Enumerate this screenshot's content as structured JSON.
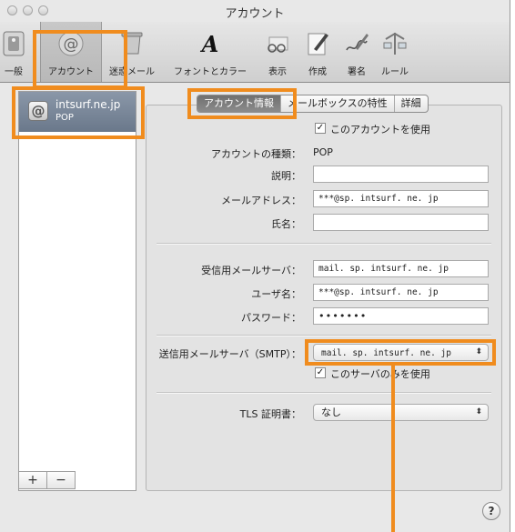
{
  "window": {
    "title": "アカウント"
  },
  "toolbar": {
    "items": [
      {
        "label": "一般",
        "icon": "switch-icon"
      },
      {
        "label": "アカウント",
        "icon": "at-sign-icon"
      },
      {
        "label": "迷惑メール",
        "icon": "junk-mail-icon"
      },
      {
        "label": "フォントとカラー",
        "icon": "font-icon"
      },
      {
        "label": "表示",
        "icon": "glasses-icon"
      },
      {
        "label": "作成",
        "icon": "compose-icon"
      },
      {
        "label": "署名",
        "icon": "signature-icon"
      },
      {
        "label": "ルール",
        "icon": "rules-icon"
      }
    ],
    "selected": "アカウント"
  },
  "sidebar": {
    "accounts": [
      {
        "name": "intsurf.ne.jp",
        "type": "POP",
        "icon": "at-sign-icon"
      }
    ],
    "add_label": "+",
    "remove_label": "−"
  },
  "tabs": [
    {
      "label": "アカウント情報",
      "active": true
    },
    {
      "label": "メールボックスの特性",
      "active": false
    },
    {
      "label": "詳細",
      "active": false
    }
  ],
  "form": {
    "enable_account": {
      "label": "このアカウントを使用",
      "checked": true
    },
    "account_type": {
      "label": "アカウントの種類：",
      "value": "POP"
    },
    "description": {
      "label": "説明：",
      "value": ""
    },
    "email": {
      "label": "メールアドレス：",
      "value": "***@sp. intsurf. ne. jp"
    },
    "full_name": {
      "label": "氏名：",
      "value": ""
    },
    "incoming_server": {
      "label": "受信用メールサーバ：",
      "value": "mail. sp. intsurf. ne. jp"
    },
    "username": {
      "label": "ユーザ名：",
      "value": "***@sp. intsurf. ne. jp"
    },
    "password": {
      "label": "パスワード：",
      "value": "•••••••"
    },
    "smtp": {
      "label": "送信用メールサーバ（SMTP）：",
      "value": "mail. sp. intsurf. ne. jp"
    },
    "only_this_server": {
      "label": "このサーバのみを使用",
      "checked": true
    },
    "tls": {
      "label": "TLS 証明書：",
      "value": "なし"
    }
  },
  "help_label": "?",
  "highlight_color": "#f08c1e"
}
